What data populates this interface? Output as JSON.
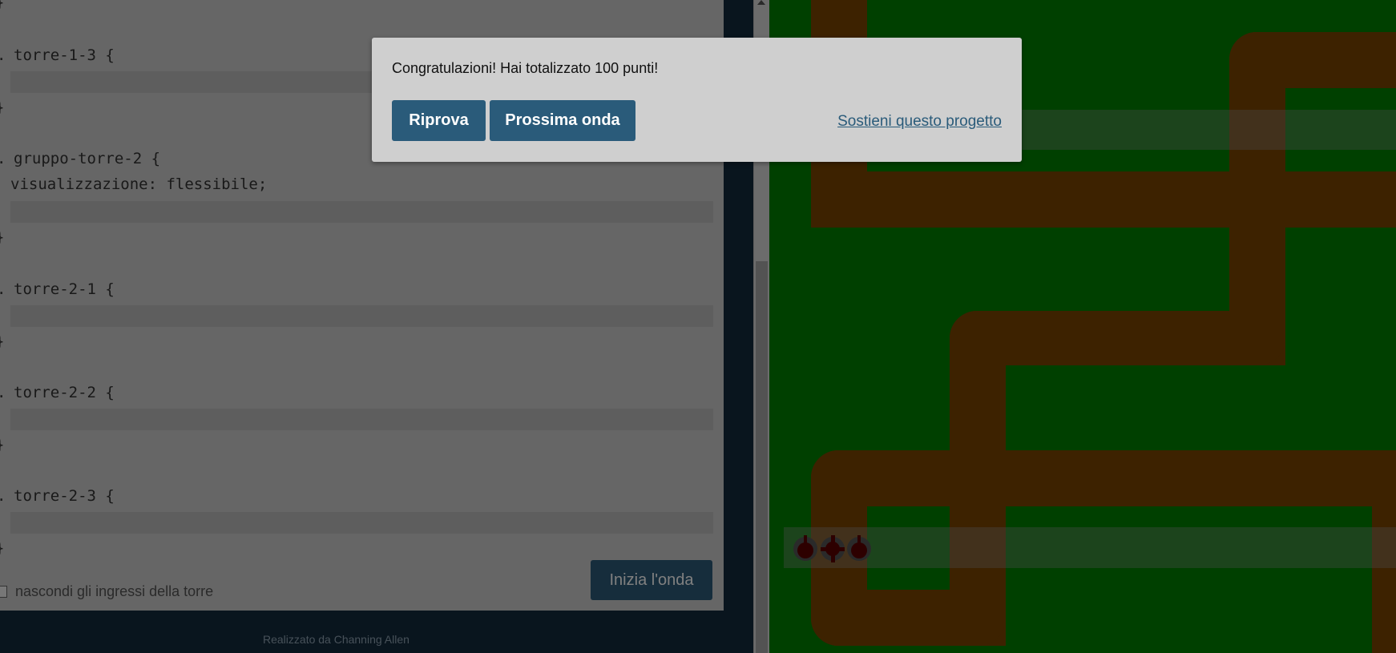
{
  "editor": {
    "rules": [
      {
        "selector": "torre-1-3 {",
        "property": "",
        "close": "}"
      },
      {
        "selector": "gruppo-torre-2 {",
        "property": "visualizzazione: flessibile;",
        "close": "}"
      },
      {
        "selector": "torre-2-1 {",
        "property": "",
        "close": "}"
      },
      {
        "selector": "torre-2-2 {",
        "property": "",
        "close": "}"
      },
      {
        "selector": "torre-2-3 {",
        "property": "",
        "close": "}"
      }
    ],
    "hide_inputs_label": "nascondi gli ingressi della torre",
    "start_wave_label": "Inizia l'onda",
    "credits": "Realizzato da Channing Allen"
  },
  "modal": {
    "message": "Congratulazioni! Hai totalizzato 100 punti!",
    "retry_label": "Riprova",
    "next_wave_label": "Prossima onda",
    "support_link": "Sostieni questo progetto"
  },
  "board": {
    "grass_color": "#008000",
    "path_color": "#7a4400",
    "tower_color": "#5a0000"
  }
}
